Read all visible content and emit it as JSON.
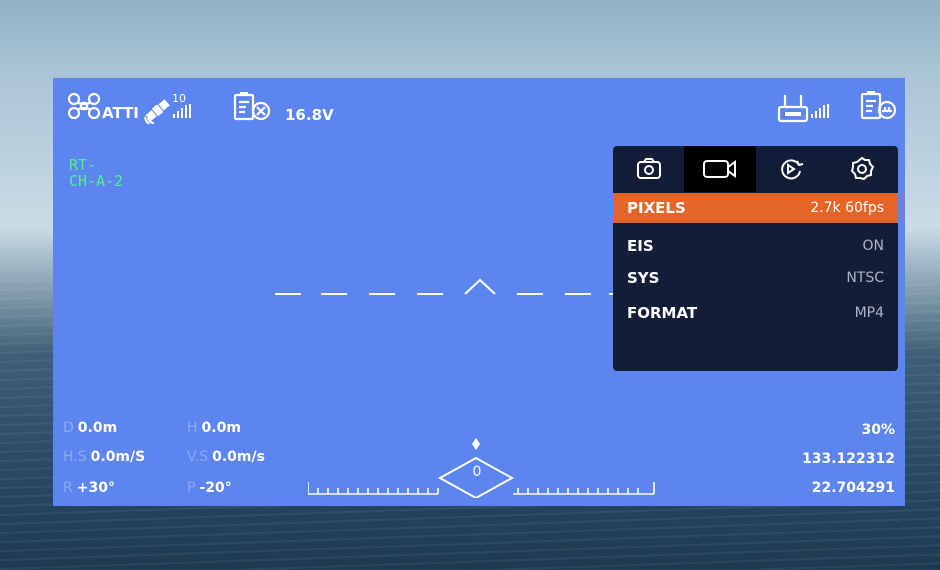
{
  "status_bar": {
    "flight_mode": "ATTI",
    "satellite_count": "10",
    "voltage": "16.8V"
  },
  "camera_id": [
    "RT-",
    "CH-A-2"
  ],
  "settings_panel": {
    "tabs": [
      "photo-tab",
      "video-tab",
      "playback-tab",
      "settings-tab"
    ],
    "active_tab": "video-tab",
    "rows": [
      {
        "key": "PIXELS",
        "value": "2.7k 60fps",
        "selected": true
      },
      {
        "key": "EIS",
        "value": "ON",
        "selected": false
      },
      {
        "key": "SYS",
        "value": "NTSC",
        "selected": false
      },
      {
        "key": "FORMAT",
        "value": "MP4",
        "selected": false
      }
    ]
  },
  "telemetry": {
    "d_label": "D",
    "d_value": "0.0m",
    "h_label": "H",
    "h_value": "0.0m",
    "hs_label": "H.S",
    "hs_value": "0.0m/S",
    "vs_label": "V.S",
    "vs_value": "0.0m/s",
    "r_label": "R",
    "r_value": "+30°",
    "p_label": "P",
    "p_value": "-20°"
  },
  "right_readout": {
    "battery": "30%",
    "longitude": "133.122312",
    "latitude": "22.704291"
  },
  "heading": "0",
  "colors": {
    "screen": "#5c85ef",
    "accent": "#e56428",
    "panel": "#131d38",
    "green": "#4af58c"
  }
}
